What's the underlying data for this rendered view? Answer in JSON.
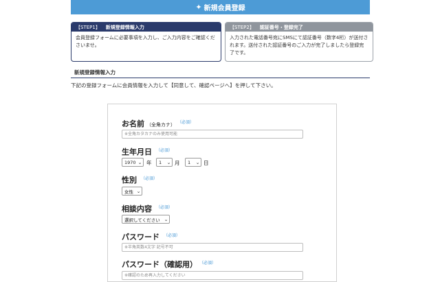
{
  "header": {
    "title": "新規会員登録",
    "icon": "sparkle-icon"
  },
  "steps": [
    {
      "num": "【STEP1】",
      "title": "新規登録情報入力",
      "desc": "会員登録フォームに必要事項を入力し、ご入力内容をご確認くださいませ。",
      "active": true
    },
    {
      "num": "【STEP2】",
      "title": "認証番号・登録完了",
      "desc": "入力された電話番号宛にSMSにて認証番号（数字4桁）が送付されます。送付された認証番号のご入力が完了しましたら登録完了です。",
      "active": false
    }
  ],
  "section": {
    "title": "新規登録情報入力",
    "desc": "下記の登録フォームに会員情報を入力して【同意して、確認ページへ】を押して下さい。"
  },
  "form": {
    "required_label": "（必須）",
    "name": {
      "label": "お名前",
      "sub": "（全角カナ）",
      "placeholder": "※全角カタカナのみ使用可能"
    },
    "birth": {
      "label": "生年月日",
      "year": "1970",
      "year_unit": "年",
      "month": "1",
      "month_unit": "月",
      "day": "1",
      "day_unit": "日"
    },
    "gender": {
      "label": "性別",
      "value": "女性"
    },
    "consult": {
      "label": "相談内容",
      "value": "選択してください"
    },
    "password": {
      "label": "パスワード",
      "placeholder": "※半角英数4文字 記号不可"
    },
    "password_confirm": {
      "label": "パスワード（確認用）",
      "placeholder": "※確認のため再入力してください"
    }
  }
}
